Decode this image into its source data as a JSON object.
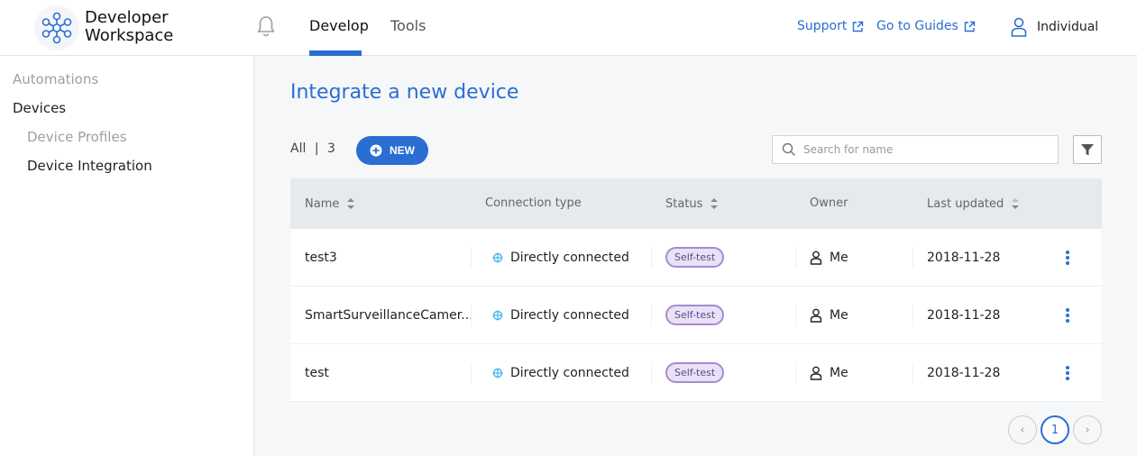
{
  "header": {
    "brand_line1": "Developer",
    "brand_line2": "Workspace",
    "tabs": [
      {
        "label": "Develop",
        "active": true
      },
      {
        "label": "Tools",
        "active": false
      }
    ],
    "links": [
      {
        "label": "Support"
      },
      {
        "label": "Go to Guides"
      }
    ],
    "user_label": "Individual",
    "accent_color": "#2a6ed2"
  },
  "sidebar": {
    "items": [
      {
        "label": "Automations"
      },
      {
        "label": "Devices"
      },
      {
        "label": "Device Profiles"
      },
      {
        "label": "Device Integration"
      }
    ]
  },
  "main": {
    "title": "Integrate a new device",
    "count_label": "All",
    "count_value": "3",
    "new_button_label": "NEW",
    "search_placeholder": "Search for name",
    "columns": [
      "Name",
      "Connection type",
      "Status",
      "Owner",
      "Last updated"
    ],
    "rows": [
      {
        "name": "test3",
        "connection": "Directly connected",
        "status": "Self-test",
        "owner": "Me",
        "updated": "2018-11-28"
      },
      {
        "name": "SmartSurveillanceCamer...",
        "connection": "Directly connected",
        "status": "Self-test",
        "owner": "Me",
        "updated": "2018-11-28"
      },
      {
        "name": "test",
        "connection": "Directly connected",
        "status": "Self-test",
        "owner": "Me",
        "updated": "2018-11-28"
      }
    ],
    "pagination": {
      "prev": "‹",
      "current": "1",
      "next": "›"
    }
  }
}
